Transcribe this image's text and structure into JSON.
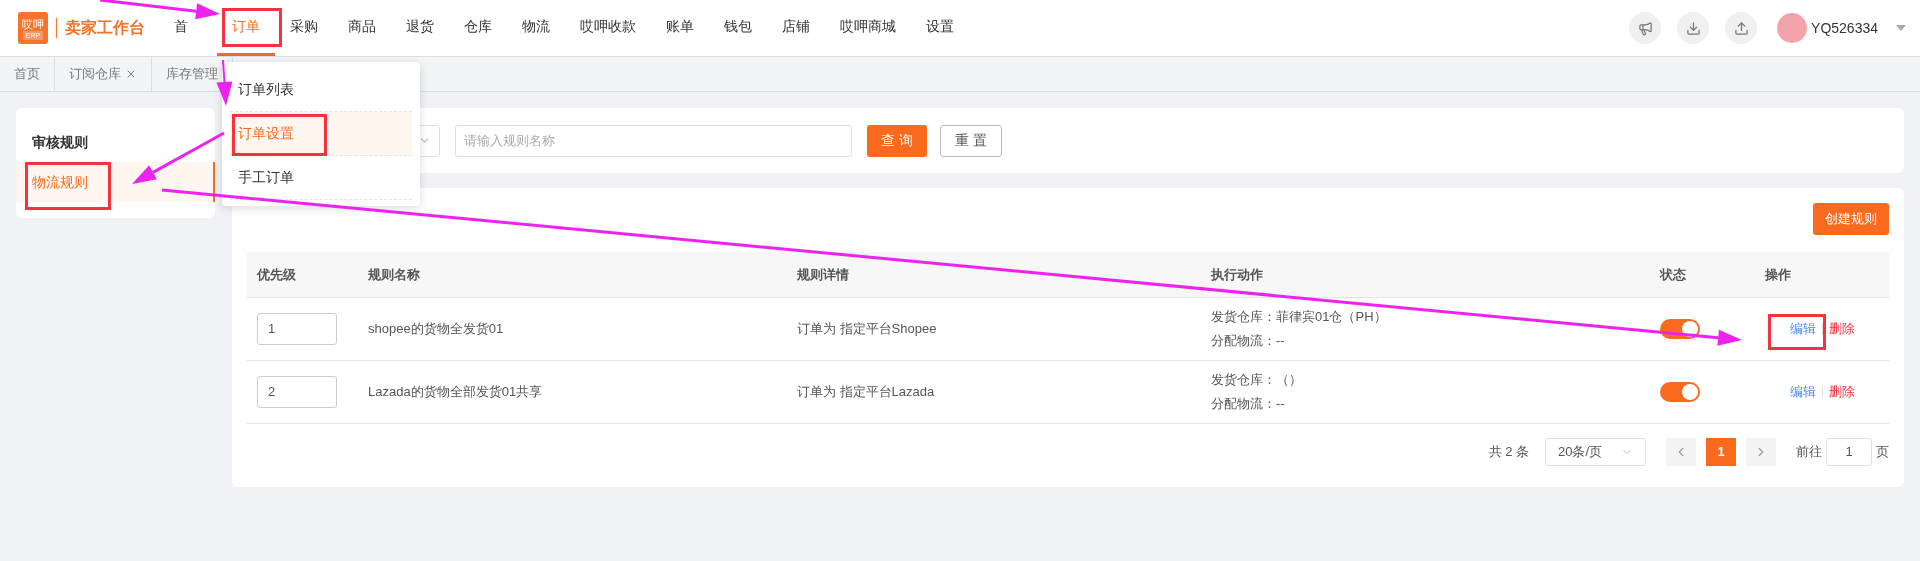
{
  "logo": {
    "badge_top": "哎呷",
    "badge_bottom": "ERP",
    "title": "卖家工作台"
  },
  "nav": [
    {
      "label": "首",
      "selected": false
    },
    {
      "label": "订单",
      "selected": true
    },
    {
      "label": "采购",
      "selected": false
    },
    {
      "label": "商品",
      "selected": false
    },
    {
      "label": "退货",
      "selected": false
    },
    {
      "label": "仓库",
      "selected": false
    },
    {
      "label": "物流",
      "selected": false
    },
    {
      "label": "哎呷收款",
      "selected": false
    },
    {
      "label": "账单",
      "selected": false
    },
    {
      "label": "钱包",
      "selected": false
    },
    {
      "label": "店铺",
      "selected": false
    },
    {
      "label": "哎呷商城",
      "selected": false
    },
    {
      "label": "设置",
      "selected": false
    }
  ],
  "user": {
    "name": "YQ526334"
  },
  "tabs": [
    {
      "label": "首页",
      "closable": false
    },
    {
      "label": "订阅仓库",
      "closable": true
    },
    {
      "label": "库存管理",
      "closable": false
    }
  ],
  "dropdown_menu": [
    {
      "label": "订单列表",
      "selected": false
    },
    {
      "label": "订单设置",
      "selected": true
    },
    {
      "label": "手工订单",
      "selected": false
    }
  ],
  "sidebar": [
    {
      "label": "审核规则",
      "selected": false
    },
    {
      "label": "物流规则",
      "selected": true
    }
  ],
  "filter": {
    "name_placeholder": "请输入规则名称",
    "buttons": [
      {
        "label": "查 询",
        "kind": "primary"
      },
      {
        "label": "重 置",
        "kind": "default"
      }
    ]
  },
  "create_button": "创建规则",
  "table": {
    "columns": [
      "优先级",
      "规则名称",
      "规则详情",
      "执行动作",
      "状态",
      "操作"
    ],
    "rows": [
      {
        "priority": "1",
        "name": "shopee的货物全发货01",
        "detail": "订单为 指定平台Shopee",
        "actions": [
          "发货仓库：菲律宾01仓（PH）",
          "分配物流：--"
        ],
        "on": true,
        "edit": "编辑",
        "delete": "删除"
      },
      {
        "priority": "2",
        "name": "Lazada的货物全部发货01共享",
        "detail": "订单为 指定平台Lazada",
        "actions": [
          "发货仓库：（）",
          "分配物流：--"
        ],
        "on": true,
        "edit": "编辑",
        "delete": "删除"
      }
    ]
  },
  "pagination": {
    "total": "共 2 条",
    "page_size": "20条/页",
    "pages": [
      {
        "label": "1",
        "selected": true
      }
    ],
    "goto_label": "前往",
    "goto_value": "1",
    "page_suffix": "页"
  }
}
